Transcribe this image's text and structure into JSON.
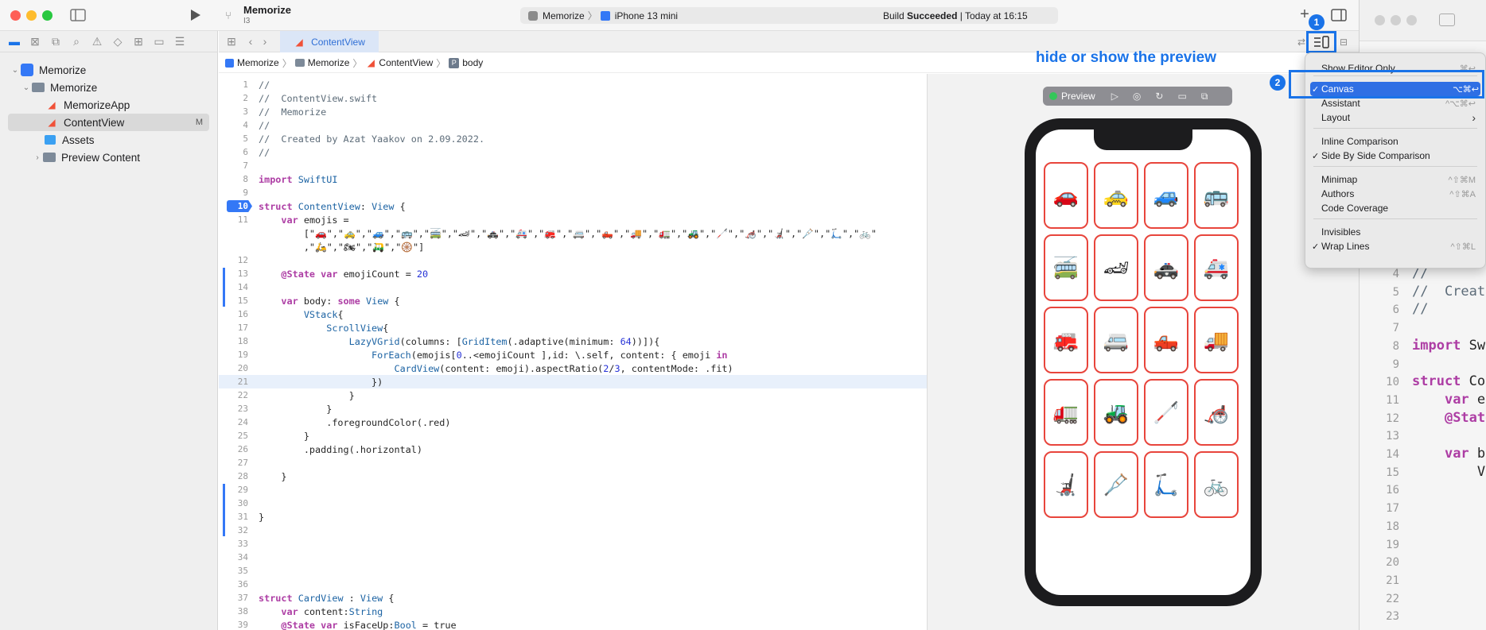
{
  "window": {
    "project_name": "Memorize",
    "branch": "I3",
    "scheme": "Memorize",
    "device": "iPhone 13 mini",
    "status_prefix": "Build ",
    "status_strong": "Succeeded",
    "status_suffix": " | Today at 16:15"
  },
  "navigator": {
    "items": [
      {
        "label": "Memorize"
      },
      {
        "label": "Memorize"
      },
      {
        "label": "MemorizeApp"
      },
      {
        "label": "ContentView",
        "badge": "M"
      },
      {
        "label": "Assets"
      },
      {
        "label": "Preview Content"
      }
    ]
  },
  "editor": {
    "tab_label": "ContentView",
    "breadcrumb": [
      "Memorize",
      "Memorize",
      "ContentView",
      "body"
    ],
    "current_line": "21",
    "code_lines": [
      {
        "n": "1",
        "t": "//"
      },
      {
        "n": "2",
        "t": "//  ContentView.swift"
      },
      {
        "n": "3",
        "t": "//  Memorize"
      },
      {
        "n": "4",
        "t": "//"
      },
      {
        "n": "5",
        "t": "//  Created by Azat Yaakov on 2.09.2022."
      },
      {
        "n": "6",
        "t": "//"
      },
      {
        "n": "7",
        "t": ""
      },
      {
        "n": "8",
        "t": "import SwiftUI"
      },
      {
        "n": "9",
        "t": ""
      },
      {
        "n": "10",
        "t": "struct ContentView: View {"
      },
      {
        "n": "11",
        "t": "    var emojis ="
      },
      {
        "n": "",
        "t": "        [\"🚗\",\"🚕\",\"🚙\",\"🚌\",\"🚎\",\"🏎\",\"🚓\",\"🚑\",\"🚒\",\"🚐\",\"🛻\",\"🚚\",\"🚛\",\"🚜\",\"🦯\",\"🦽\",\"🦼\",\"🩼\",\"🛴\",\"🚲\""
      },
      {
        "n": "",
        "t": "        ,\"🛵\",\"🏍\",\"🛺\",\"🛞\"]"
      },
      {
        "n": "12",
        "t": ""
      },
      {
        "n": "13",
        "t": "    @State var emojiCount = 20"
      },
      {
        "n": "14",
        "t": ""
      },
      {
        "n": "15",
        "t": "    var body: some View {"
      },
      {
        "n": "16",
        "t": "        VStack{"
      },
      {
        "n": "17",
        "t": "            ScrollView{"
      },
      {
        "n": "18",
        "t": "                LazyVGrid(columns: [GridItem(.adaptive(minimum: 64))]){"
      },
      {
        "n": "19",
        "t": "                    ForEach(emojis[0..<emojiCount ],id: \\.self, content: { emoji in"
      },
      {
        "n": "20",
        "t": "                        CardView(content: emoji).aspectRatio(2/3, contentMode: .fit)"
      },
      {
        "n": "21",
        "t": "                    })"
      },
      {
        "n": "22",
        "t": "                }"
      },
      {
        "n": "23",
        "t": "            }"
      },
      {
        "n": "24",
        "t": "            .foregroundColor(.red)"
      },
      {
        "n": "25",
        "t": "        }"
      },
      {
        "n": "26",
        "t": "        .padding(.horizontal)"
      },
      {
        "n": "27",
        "t": ""
      },
      {
        "n": "28",
        "t": "    }"
      },
      {
        "n": "29",
        "t": ""
      },
      {
        "n": "30",
        "t": ""
      },
      {
        "n": "31",
        "t": "}"
      },
      {
        "n": "32",
        "t": ""
      },
      {
        "n": "33",
        "t": ""
      },
      {
        "n": "34",
        "t": ""
      },
      {
        "n": "35",
        "t": ""
      },
      {
        "n": "36",
        "t": ""
      },
      {
        "n": "37",
        "t": "struct CardView : View {"
      },
      {
        "n": "38",
        "t": "    var content:String"
      },
      {
        "n": "39",
        "t": "    @State var isFaceUp:Bool = true"
      }
    ]
  },
  "annotation": {
    "text": "hide or show the preview",
    "badge1": "1",
    "badge2": "2",
    "accent": "#1a73e8"
  },
  "preview": {
    "label": "Preview",
    "card_border": "#e8453c",
    "cards": [
      "🚗",
      "🚕",
      "🚙",
      "🚌",
      "🚎",
      "🏎",
      "🚓",
      "🚑",
      "🚒",
      "🚐",
      "🛻",
      "🚚",
      "🚛",
      "🚜",
      "🦯",
      "🦽",
      "🦼",
      "🩼",
      "🛴",
      "🚲"
    ]
  },
  "menu": {
    "items": [
      {
        "label": "Show Editor Only",
        "shortcut": "⌘↩",
        "checked": ""
      },
      {
        "label": "Canvas",
        "shortcut": "⌥⌘↩",
        "checked": "✓"
      },
      {
        "label": "Assistant",
        "shortcut": "^⌥⌘↩",
        "checked": ""
      },
      {
        "label": "Layout",
        "shortcut": "›",
        "checked": ""
      },
      {
        "label": "Inline Comparison",
        "shortcut": "",
        "checked": ""
      },
      {
        "label": "Side By Side Comparison",
        "shortcut": "",
        "checked": "✓"
      },
      {
        "label": "Minimap",
        "shortcut": "^⇧⌘M",
        "checked": ""
      },
      {
        "label": "Authors",
        "shortcut": "^⇧⌘A",
        "checked": ""
      },
      {
        "label": "Code Coverage",
        "shortcut": "",
        "checked": ""
      },
      {
        "label": "Invisibles",
        "shortcut": "",
        "checked": ""
      },
      {
        "label": "Wrap Lines",
        "shortcut": "^⇧⌘L",
        "checked": "✓"
      }
    ]
  },
  "right_window": {
    "lines": [
      {
        "n": "4",
        "t": "//"
      },
      {
        "n": "5",
        "t": "//  Create"
      },
      {
        "n": "6",
        "t": "//"
      },
      {
        "n": "7",
        "t": ""
      },
      {
        "n": "8",
        "t": "import Swi"
      },
      {
        "n": "9",
        "t": ""
      },
      {
        "n": "10",
        "t": "struct Con"
      },
      {
        "n": "11",
        "t": "    var em"
      },
      {
        "n": "12",
        "t": "    @State"
      },
      {
        "n": "13",
        "t": ""
      },
      {
        "n": "14",
        "t": "    var bo"
      },
      {
        "n": "15",
        "t": "        VS"
      },
      {
        "n": "16",
        "t": ""
      },
      {
        "n": "17",
        "t": ""
      },
      {
        "n": "18",
        "t": ""
      },
      {
        "n": "19",
        "t": ""
      },
      {
        "n": "20",
        "t": ""
      },
      {
        "n": "21",
        "t": ""
      },
      {
        "n": "22",
        "t": ""
      },
      {
        "n": "23",
        "t": ""
      }
    ]
  }
}
